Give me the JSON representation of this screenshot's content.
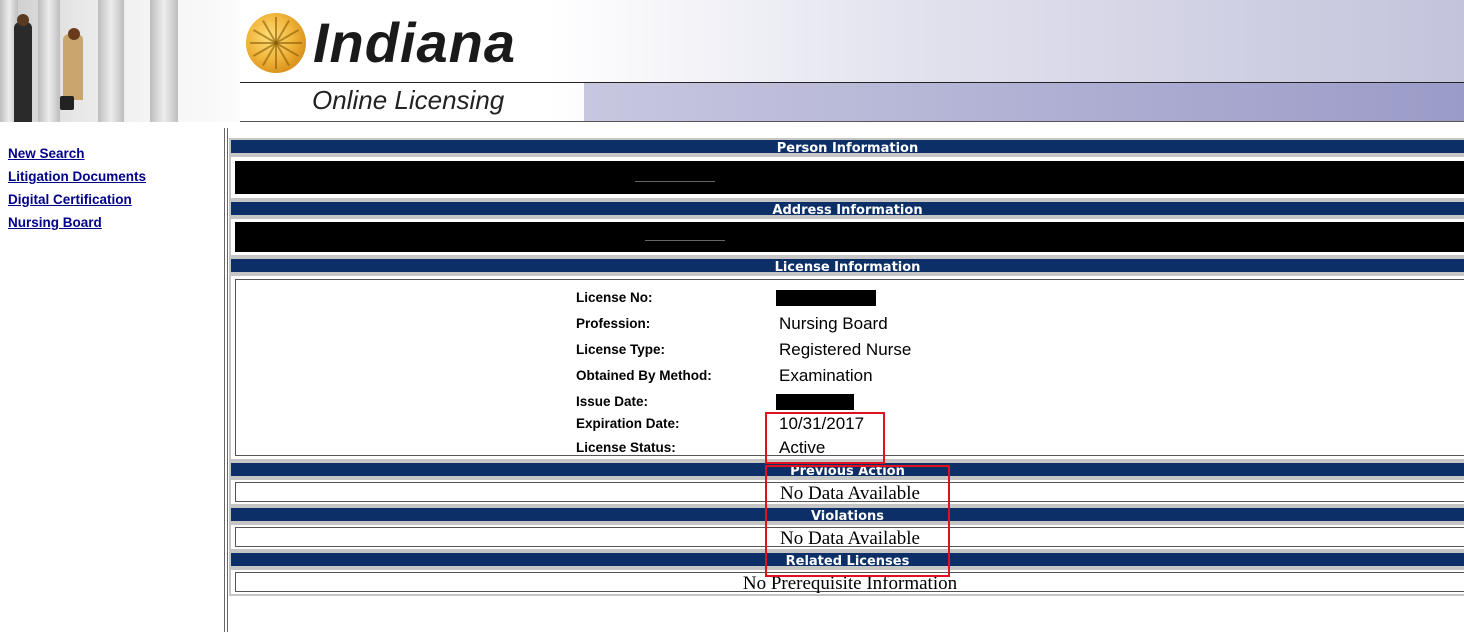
{
  "header": {
    "brand": "Indiana",
    "subtitle": "Online Licensing"
  },
  "sidebar": {
    "items": [
      {
        "label": "New Search"
      },
      {
        "label": "Litigation Documents"
      },
      {
        "label": "Digital Certification"
      },
      {
        "label": "Nursing Board"
      }
    ]
  },
  "sections": {
    "person": {
      "title": "Person Information"
    },
    "address": {
      "title": "Address Information"
    },
    "license": {
      "title": "License Information"
    },
    "previous_action": {
      "title": "Previous Action",
      "text": "No Data Available"
    },
    "violations": {
      "title": "Violations",
      "text": "No Data Available"
    },
    "related": {
      "title": "Related Licenses",
      "text": "No Prerequisite Information"
    }
  },
  "license": {
    "fields": [
      {
        "label": "License No:",
        "value": ""
      },
      {
        "label": "Profession:",
        "value": "Nursing Board"
      },
      {
        "label": "License Type:",
        "value": "Registered Nurse"
      },
      {
        "label": "Obtained By Method:",
        "value": "Examination"
      },
      {
        "label": "Issue Date:",
        "value": ""
      },
      {
        "label": "Expiration Date:",
        "value": "10/31/2017"
      },
      {
        "label": "License Status:",
        "value": "Active"
      }
    ]
  },
  "colors": {
    "section_bar": "#0b2f66",
    "link": "#00008b",
    "highlight": "#e0101e"
  }
}
